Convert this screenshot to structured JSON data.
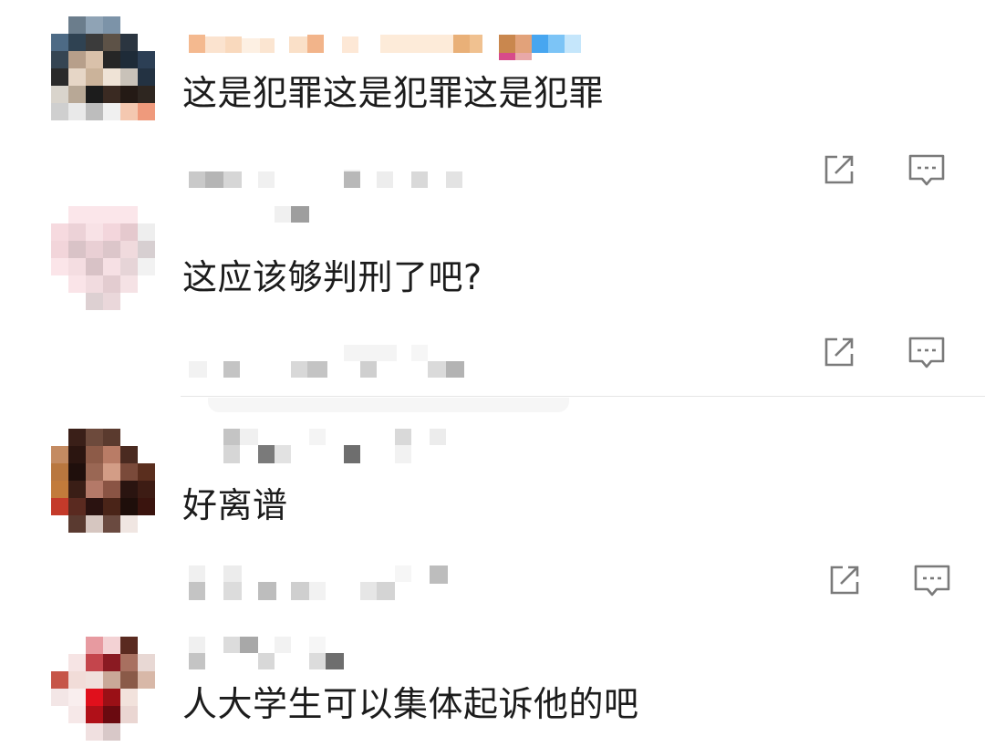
{
  "comments": [
    {
      "text": "这是犯罪这是犯罪这是犯罪",
      "share_icon": "share-icon",
      "reply_icon": "comment-icon"
    },
    {
      "text": "这应该够判刑了吧?",
      "share_icon": "share-icon",
      "reply_icon": "comment-icon"
    },
    {
      "text": "好离谱",
      "share_icon": "share-icon",
      "reply_icon": "comment-icon"
    },
    {
      "text": "人大学生可以集体起诉他的吧"
    }
  ],
  "colors": {
    "text": "#1c1c1c",
    "icon": "#7a7a7a",
    "divider": "#e6e6e6"
  }
}
